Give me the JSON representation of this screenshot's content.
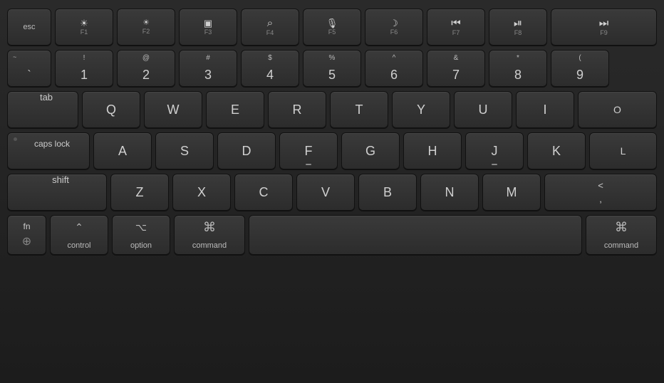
{
  "keyboard": {
    "rows": {
      "fn_row": {
        "esc": "esc",
        "f1": "F1",
        "f2": "F2",
        "f3": "F3",
        "f4": "F4",
        "f5": "F5",
        "f6": "F6",
        "f7": "F7",
        "f8": "F8",
        "f9": "F9",
        "f1_icon": "☀",
        "f2_icon": "☀",
        "f3_icon": "⊞",
        "f4_icon": "⌕",
        "f5_icon": "🎤",
        "f6_icon": "☾",
        "f7_icon": "⏮",
        "f8_icon": "⏯",
        "f9_icon": "⏭"
      },
      "num_row": {
        "backtick_top": "~",
        "backtick_bot": "`",
        "keys": [
          {
            "top": "!",
            "bot": "1"
          },
          {
            "top": "@",
            "bot": "2"
          },
          {
            "top": "#",
            "bot": "3"
          },
          {
            "top": "$",
            "bot": "4"
          },
          {
            "top": "%",
            "bot": "5"
          },
          {
            "top": "^",
            "bot": "6"
          },
          {
            "top": "&",
            "bot": "7"
          },
          {
            "top": "*",
            "bot": "8"
          },
          {
            "top": "(",
            "bot": "9"
          }
        ]
      },
      "qwerty_row": {
        "tab": "tab",
        "keys": [
          "Q",
          "W",
          "E",
          "R",
          "T",
          "Y",
          "U",
          "I",
          "O"
        ]
      },
      "asdf_row": {
        "caps": "caps lock",
        "keys": [
          "A",
          "S",
          "D",
          "F",
          "G",
          "H",
          "J",
          "K",
          "L"
        ]
      },
      "zxcv_row": {
        "shift": "shift",
        "keys": [
          "Z",
          "X",
          "C",
          "V",
          "B",
          "N",
          "M"
        ],
        "lt_top": "<",
        "lt_bot": ","
      },
      "bottom_row": {
        "fn": "fn",
        "globe_icon": "⊕",
        "control_icon": "^",
        "control": "control",
        "option_icon": "⌥",
        "option": "option",
        "command_icon": "⌘",
        "command": "command",
        "command_r": "command",
        "command_r_icon": "⌘"
      }
    }
  }
}
